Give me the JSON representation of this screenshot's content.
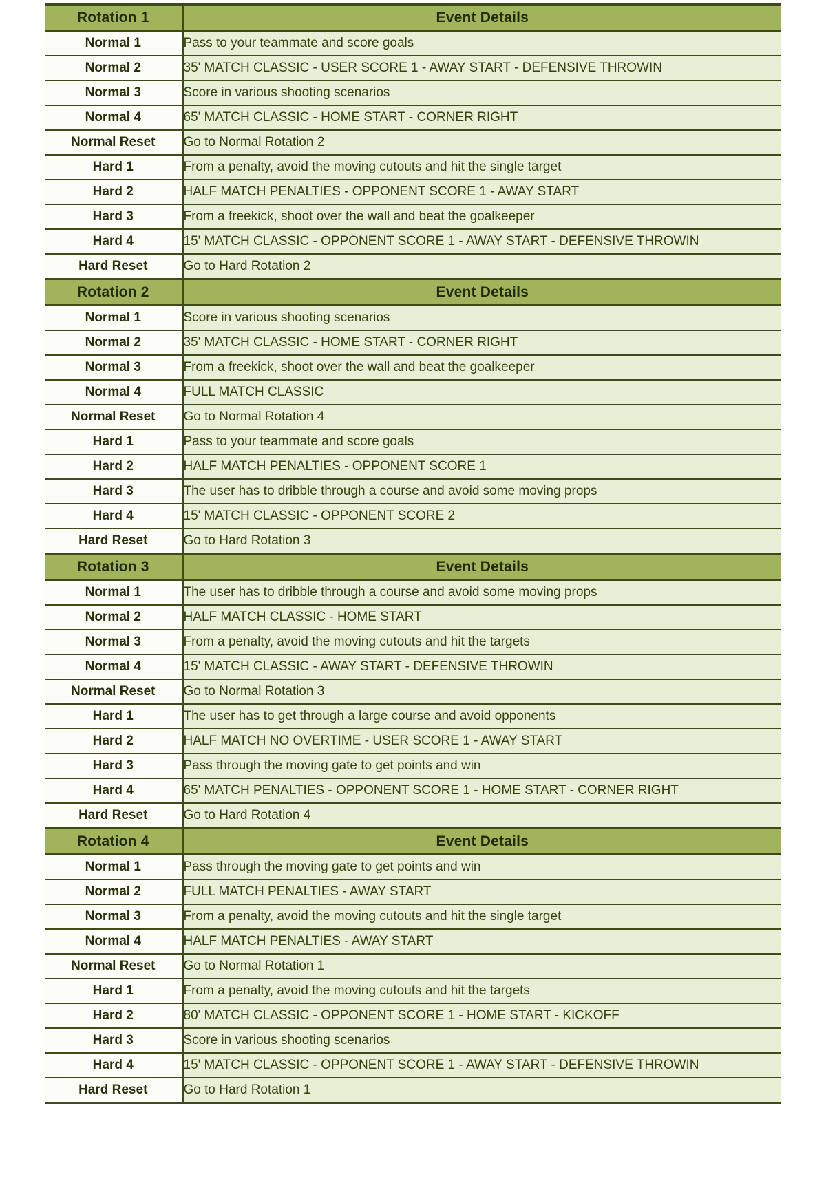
{
  "table": {
    "colors": {
      "header_bg": "#a1b35b",
      "label_bg": "#fdfdf7",
      "detail_bg": "#e9eed7",
      "border": "#3f4a18",
      "text": "#33430f"
    },
    "columns": {
      "label_header_generic": "Rotation",
      "detail_header": "Event Details"
    },
    "sections": [
      {
        "header": {
          "label": "Rotation 1",
          "detail": "Event Details"
        },
        "rows": [
          {
            "label": "Normal 1",
            "detail": "Pass to your teammate and score goals"
          },
          {
            "label": "Normal 2",
            "detail": "35' MATCH CLASSIC - USER SCORE 1 - AWAY START - DEFENSIVE THROWIN"
          },
          {
            "label": "Normal 3",
            "detail": "Score in various shooting scenarios"
          },
          {
            "label": "Normal 4",
            "detail": "65' MATCH CLASSIC - HOME START - CORNER RIGHT"
          },
          {
            "label": "Normal Reset",
            "detail": "Go to Normal Rotation 2"
          },
          {
            "label": "Hard 1",
            "detail": "From a penalty, avoid the moving cutouts and hit the single target"
          },
          {
            "label": "Hard 2",
            "detail": "HALF MATCH PENALTIES - OPPONENT SCORE 1 - AWAY START"
          },
          {
            "label": "Hard 3",
            "detail": "From a freekick, shoot over the wall and beat the goalkeeper"
          },
          {
            "label": "Hard 4",
            "detail": "15' MATCH CLASSIC - OPPONENT SCORE 1 - AWAY START - DEFENSIVE THROWIN"
          },
          {
            "label": "Hard Reset",
            "detail": "Go to Hard Rotation 2"
          }
        ]
      },
      {
        "header": {
          "label": "Rotation 2",
          "detail": "Event Details"
        },
        "rows": [
          {
            "label": "Normal 1",
            "detail": "Score in various shooting scenarios"
          },
          {
            "label": "Normal 2",
            "detail": "35' MATCH CLASSIC - HOME START - CORNER RIGHT"
          },
          {
            "label": "Normal 3",
            "detail": "From a freekick, shoot over the wall and beat the goalkeeper"
          },
          {
            "label": "Normal 4",
            "detail": "FULL MATCH CLASSIC"
          },
          {
            "label": "Normal Reset",
            "detail": "Go to Normal Rotation 4"
          },
          {
            "label": "Hard 1",
            "detail": "Pass to your teammate and score goals"
          },
          {
            "label": "Hard 2",
            "detail": "HALF MATCH PENALTIES - OPPONENT SCORE 1"
          },
          {
            "label": "Hard 3",
            "detail": "The user has to dribble through a course and avoid some moving props"
          },
          {
            "label": "Hard 4",
            "detail": "15' MATCH CLASSIC - OPPONENT SCORE 2"
          },
          {
            "label": "Hard Reset",
            "detail": "Go to Hard Rotation 3"
          }
        ]
      },
      {
        "header": {
          "label": "Rotation 3",
          "detail": "Event Details"
        },
        "rows": [
          {
            "label": "Normal 1",
            "detail": "The user has to dribble through a course and avoid some moving props"
          },
          {
            "label": "Normal 2",
            "detail": "HALF MATCH CLASSIC - HOME START"
          },
          {
            "label": "Normal 3",
            "detail": "From a penalty, avoid the moving cutouts and hit the targets"
          },
          {
            "label": "Normal 4",
            "detail": "15' MATCH CLASSIC - AWAY START - DEFENSIVE THROWIN"
          },
          {
            "label": "Normal Reset",
            "detail": "Go to Normal Rotation 3"
          },
          {
            "label": "Hard 1",
            "detail": "The user has to get through a large course and avoid opponents"
          },
          {
            "label": "Hard 2",
            "detail": "HALF MATCH NO OVERTIME - USER SCORE 1 - AWAY START"
          },
          {
            "label": "Hard 3",
            "detail": "Pass through the moving gate to get points and win"
          },
          {
            "label": "Hard 4",
            "detail": "65' MATCH PENALTIES - OPPONENT SCORE 1 - HOME START - CORNER RIGHT"
          },
          {
            "label": "Hard Reset",
            "detail": "Go to Hard Rotation 4"
          }
        ]
      },
      {
        "header": {
          "label": "Rotation 4",
          "detail": "Event Details"
        },
        "rows": [
          {
            "label": "Normal 1",
            "detail": "Pass through the moving gate to get points and win"
          },
          {
            "label": "Normal 2",
            "detail": "FULL MATCH PENALTIES - AWAY START"
          },
          {
            "label": "Normal 3",
            "detail": "From a penalty, avoid the moving cutouts and hit the single target"
          },
          {
            "label": "Normal 4",
            "detail": "HALF MATCH PENALTIES - AWAY START"
          },
          {
            "label": "Normal Reset",
            "detail": "Go to Normal Rotation 1"
          },
          {
            "label": "Hard 1",
            "detail": "From a penalty, avoid the moving cutouts and hit the targets"
          },
          {
            "label": "Hard 2",
            "detail": "80' MATCH CLASSIC - OPPONENT SCORE 1 - HOME START - KICKOFF"
          },
          {
            "label": "Hard 3",
            "detail": "Score in various shooting scenarios"
          },
          {
            "label": "Hard 4",
            "detail": "15' MATCH CLASSIC - OPPONENT SCORE 1 - AWAY START - DEFENSIVE THROWIN"
          },
          {
            "label": "Hard Reset",
            "detail": "Go to Hard Rotation 1"
          }
        ]
      }
    ]
  }
}
